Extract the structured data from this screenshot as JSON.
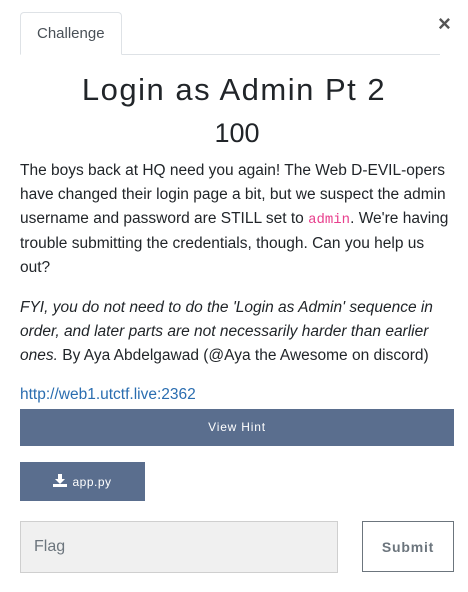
{
  "modal": {
    "close_glyph": "×"
  },
  "tabs": [
    {
      "label": "Challenge"
    }
  ],
  "challenge": {
    "name": "Login as Admin Pt 2",
    "value": "100",
    "description": {
      "p1_before": "The boys back at HQ need you again! The Web D-EVIL-opers have changed their login page a bit, but we suspect the admin username and password are STILL set to ",
      "p1_code": "admin",
      "p1_after": ". We're having trouble submitting the credentials, though. Can you help us out?",
      "p2_italic": "FYI, you do not need to do the 'Login as Admin' sequence in order, and later parts are not necessarily harder than earlier ones.",
      "p2_after": " By Aya Abdelgawad (@Aya the Awesome on discord)"
    },
    "link": "http://web1.utctf.live:2362"
  },
  "buttons": {
    "view_hint": "View Hint",
    "file": "app.py",
    "file_icon": "download-icon",
    "submit": "Submit"
  },
  "flag_input": {
    "placeholder": "Flag",
    "value": ""
  },
  "colors": {
    "button_bg": "#5a6e8e",
    "code": "#e83e8c",
    "link": "#2a6db0"
  }
}
